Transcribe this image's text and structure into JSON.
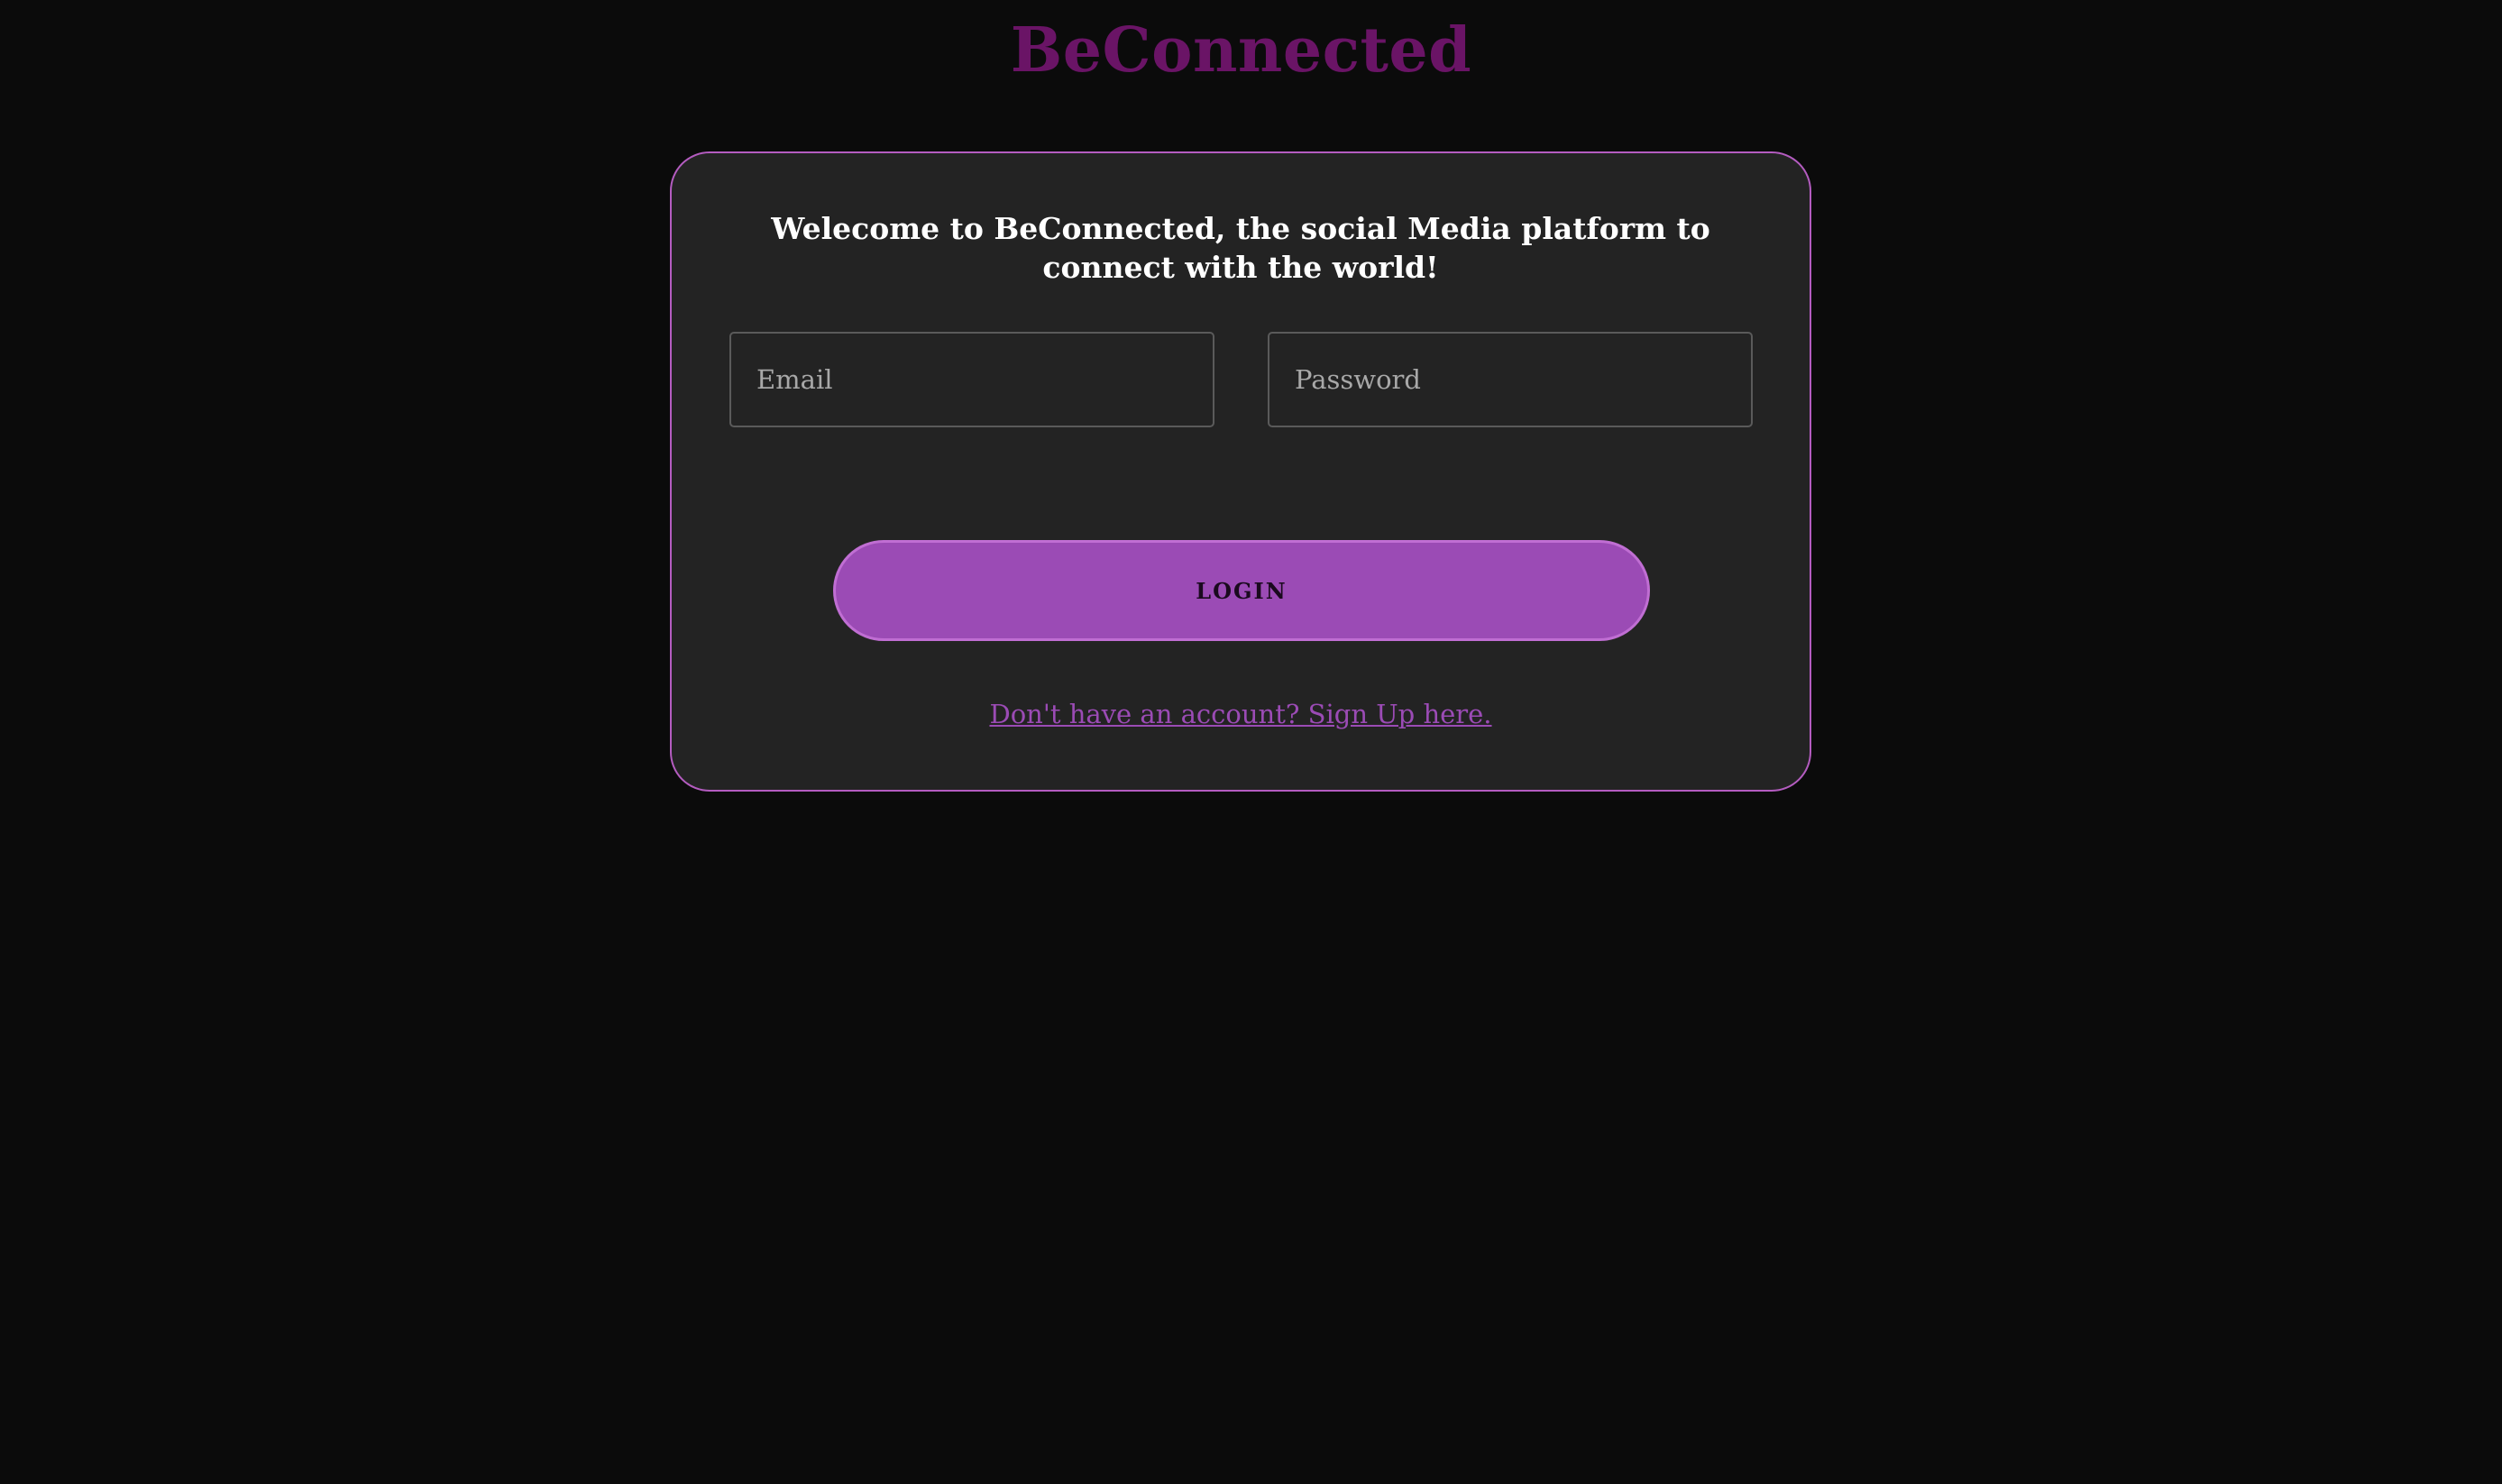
{
  "header": {
    "brand": "BeConnected"
  },
  "login_card": {
    "welcome_text": "Welecome to BeConnected, the social Media platform to connect with the world!",
    "email": {
      "placeholder": "Email",
      "value": ""
    },
    "password": {
      "placeholder": "Password",
      "value": ""
    },
    "login_label": "LOGIN",
    "signup_link": "Don't have an account? Sign Up here."
  },
  "colors": {
    "background": "#0b0b0b",
    "brand": "#6a1466",
    "card_background": "#232323",
    "card_border": "#b45cc0",
    "accent": "#9b4bb5"
  }
}
